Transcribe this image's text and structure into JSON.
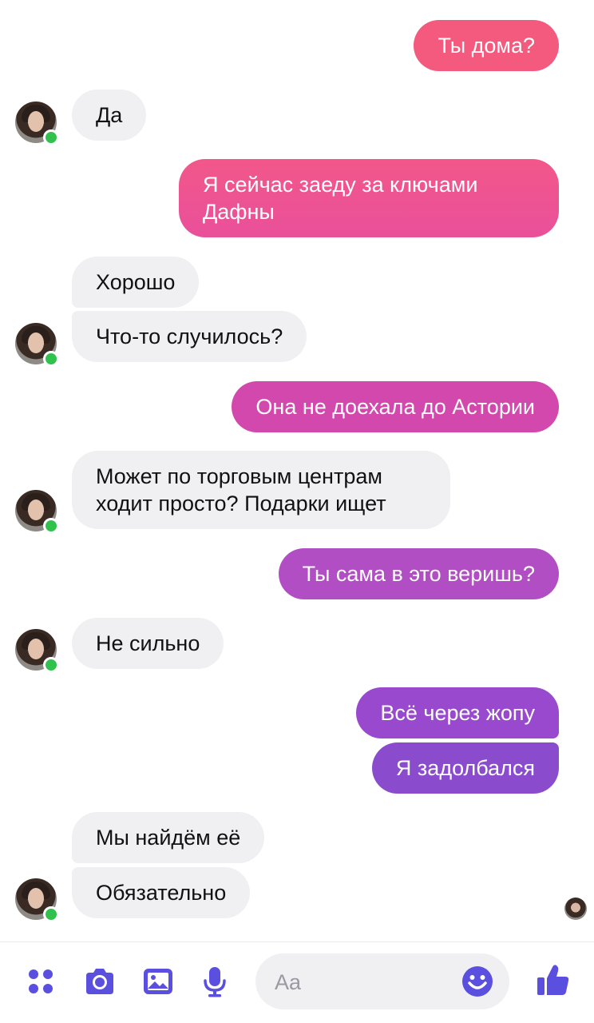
{
  "conversation": {
    "messages": [
      {
        "from": "me",
        "text": "Ты дома?",
        "color": "#f35a7e"
      },
      {
        "from": "contact",
        "text": "Да"
      },
      {
        "from": "me",
        "line1": "Я сейчас заеду за ключами",
        "line2": "Дафны",
        "color": "#ee5391"
      },
      {
        "from": "contact",
        "text": "Хорошо"
      },
      {
        "from": "contact",
        "text": "Что-то случилось?"
      },
      {
        "from": "me",
        "text": "Она не доехала до Астории",
        "color": "#d248ac"
      },
      {
        "from": "contact",
        "line1": "Может по торговым центрам",
        "line2": "ходит просто? Подарки ищет"
      },
      {
        "from": "me",
        "text": "Ты сама в это веришь?",
        "color": "#b24ec3"
      },
      {
        "from": "contact",
        "text": "Не сильно"
      },
      {
        "from": "me",
        "text": "Всё через жопу",
        "color": "#9849cd"
      },
      {
        "from": "me",
        "text": "Я задолбался",
        "color": "#8a4ccd"
      },
      {
        "from": "contact",
        "text": "Мы найдём её"
      },
      {
        "from": "contact",
        "text": "Обязательно"
      }
    ]
  },
  "composer": {
    "placeholder": "Aa",
    "icons": [
      "apps-icon",
      "camera-icon",
      "gallery-icon",
      "microphone-icon",
      "emoji-icon",
      "thumbs-up-icon"
    ],
    "accent_color": "#5b4fe0"
  },
  "colors": {
    "incoming_bubble": "#f0f0f3",
    "online_dot": "#31c24d"
  }
}
